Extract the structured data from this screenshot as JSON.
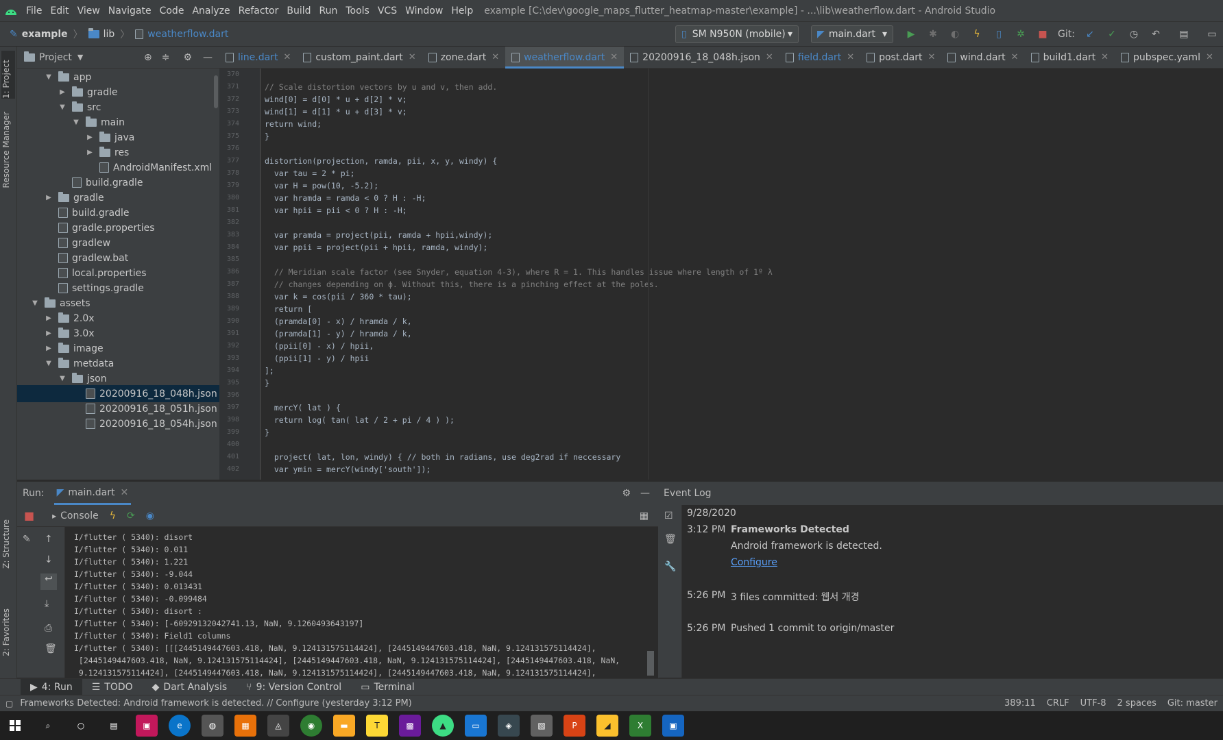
{
  "menu": {
    "items": [
      "File",
      "Edit",
      "View",
      "Navigate",
      "Code",
      "Analyze",
      "Refactor",
      "Build",
      "Run",
      "Tools",
      "VCS",
      "Window",
      "Help"
    ],
    "window_title": "example [C:\\dev\\google_maps_flutter_heatmap-master\\example] - ...\\lib\\weatherflow.dart - Android Studio"
  },
  "nav": {
    "breadcrumb": [
      "example",
      "lib",
      "weatherflow.dart"
    ],
    "device": "SM N950N (mobile)",
    "run_config": "main.dart",
    "git_label": "Git:"
  },
  "project_panel": {
    "title": "Project",
    "tree": [
      {
        "label": "app",
        "indent": 2,
        "arrow": "down",
        "kind": "folder"
      },
      {
        "label": "gradle",
        "indent": 3,
        "arrow": "right",
        "kind": "folder"
      },
      {
        "label": "src",
        "indent": 3,
        "arrow": "down",
        "kind": "folder"
      },
      {
        "label": "main",
        "indent": 4,
        "arrow": "down",
        "kind": "folder"
      },
      {
        "label": "java",
        "indent": 5,
        "arrow": "right",
        "kind": "folder"
      },
      {
        "label": "res",
        "indent": 5,
        "arrow": "right",
        "kind": "folder"
      },
      {
        "label": "AndroidManifest.xml",
        "indent": 5,
        "arrow": "",
        "kind": "file"
      },
      {
        "label": "build.gradle",
        "indent": 3,
        "arrow": "",
        "kind": "file"
      },
      {
        "label": "gradle",
        "indent": 2,
        "arrow": "right",
        "kind": "folder"
      },
      {
        "label": "build.gradle",
        "indent": 2,
        "arrow": "",
        "kind": "file"
      },
      {
        "label": "gradle.properties",
        "indent": 2,
        "arrow": "",
        "kind": "file"
      },
      {
        "label": "gradlew",
        "indent": 2,
        "arrow": "",
        "kind": "file"
      },
      {
        "label": "gradlew.bat",
        "indent": 2,
        "arrow": "",
        "kind": "file"
      },
      {
        "label": "local.properties",
        "indent": 2,
        "arrow": "",
        "kind": "file"
      },
      {
        "label": "settings.gradle",
        "indent": 2,
        "arrow": "",
        "kind": "file"
      },
      {
        "label": "assets",
        "indent": 1,
        "arrow": "down",
        "kind": "folder"
      },
      {
        "label": "2.0x",
        "indent": 2,
        "arrow": "right",
        "kind": "folder"
      },
      {
        "label": "3.0x",
        "indent": 2,
        "arrow": "right",
        "kind": "folder"
      },
      {
        "label": "image",
        "indent": 2,
        "arrow": "right",
        "kind": "folder"
      },
      {
        "label": "metdata",
        "indent": 2,
        "arrow": "down",
        "kind": "folder"
      },
      {
        "label": "json",
        "indent": 3,
        "arrow": "down",
        "kind": "folder"
      },
      {
        "label": "20200916_18_048h.json",
        "indent": 4,
        "arrow": "",
        "kind": "file",
        "selected": true
      },
      {
        "label": "20200916_18_051h.json",
        "indent": 4,
        "arrow": "",
        "kind": "file"
      },
      {
        "label": "20200916_18_054h.json",
        "indent": 4,
        "arrow": "",
        "kind": "file"
      }
    ]
  },
  "left_strip": {
    "project": "1: Project",
    "resource": "Resource Manager",
    "structure": "Z: Structure",
    "favorites": "2: Favorites"
  },
  "tabs": [
    {
      "label": "line.dart",
      "active": false,
      "color": "#4a88c7"
    },
    {
      "label": "custom_paint.dart",
      "active": false,
      "color": "#c8c8c8"
    },
    {
      "label": "zone.dart",
      "active": false,
      "color": "#c8c8c8"
    },
    {
      "label": "weatherflow.dart",
      "active": true,
      "color": "#4a88c7"
    },
    {
      "label": "20200916_18_048h.json",
      "active": false,
      "color": "#c8c8c8"
    },
    {
      "label": "field.dart",
      "active": false,
      "color": "#4a88c7"
    },
    {
      "label": "post.dart",
      "active": false,
      "color": "#c8c8c8"
    },
    {
      "label": "wind.dart",
      "active": false,
      "color": "#c8c8c8"
    },
    {
      "label": "build1.dart",
      "active": false,
      "color": "#c8c8c8"
    },
    {
      "label": "pubspec.yaml",
      "active": false,
      "color": "#c8c8c8"
    }
  ],
  "code": {
    "line_numbers": [
      "370",
      "371",
      "372",
      "373",
      "374",
      "375",
      "376",
      "377",
      "378",
      "379",
      "380",
      "381",
      "382",
      "383",
      "384",
      "385",
      "386",
      "387",
      "388",
      "389",
      "390",
      "391",
      "392",
      "393",
      "394",
      "395",
      "396",
      "397",
      "398",
      "399",
      "400",
      "401",
      "402"
    ],
    "lines": [
      "",
      "// Scale distortion vectors by u and v, then add.",
      "wind[0] = d[0] * u + d[2] * v;",
      "wind[1] = d[1] * u + d[3] * v;",
      "return wind;",
      "}",
      "",
      "distortion(projection, ramda, pii, x, y, windy) {",
      "  var tau = 2 * pi;",
      "  var H = pow(10, -5.2);",
      "  var hramda = ramda < 0 ? H : -H;",
      "  var hpii = pii < 0 ? H : -H;",
      "",
      "  var pramda = project(pii, ramda + hpii,windy);",
      "  var ppii = project(pii + hpii, ramda, windy);",
      "",
      "  // Meridian scale factor (see Snyder, equation 4-3), where R = 1. This handles issue where length of 1º λ",
      "  // changes depending on ϕ. Without this, there is a pinching effect at the poles.",
      "  var k = cos(pii / 360 * tau);",
      "  return [",
      "  (pramda[0] - x) / hramda / k,",
      "  (pramda[1] - y) / hramda / k,",
      "  (ppii[0] - x) / hpii,",
      "  (ppii[1] - y) / hpii",
      "];",
      "}",
      "",
      "  mercY( lat ) {",
      "  return log( tan( lat / 2 + pi / 4 ) );",
      "}",
      "",
      "  project( lat, lon, windy) { // both in radians, use deg2rad if neccessary",
      "  var ymin = mercY(windy['south']);"
    ]
  },
  "run_panel": {
    "label": "Run:",
    "tab": "main.dart",
    "console_tab": "Console",
    "output": [
      "I/flutter ( 5340): disort",
      "I/flutter ( 5340): 0.011",
      "I/flutter ( 5340): 1.221",
      "I/flutter ( 5340): -9.044",
      "I/flutter ( 5340): 0.013431",
      "I/flutter ( 5340): -0.099484",
      "I/flutter ( 5340): disort :",
      "I/flutter ( 5340): [-60929132042741.13, NaN, 9.1260493643197]",
      "I/flutter ( 5340): Field1 columns",
      "I/flutter ( 5340): [[[2445149447603.418, NaN, 9.124131575114424], [2445149447603.418, NaN, 9.124131575114424],",
      " [2445149447603.418, NaN, 9.124131575114424], [2445149447603.418, NaN, 9.124131575114424], [2445149447603.418, NaN,",
      " 9.124131575114424], [2445149447603.418, NaN, 9.124131575114424], [2445149447603.418, NaN, 9.124131575114424],"
    ]
  },
  "event_log": {
    "title": "Event Log",
    "date": "9/28/2020",
    "entries": [
      {
        "time": "3:12 PM",
        "title": "Frameworks Detected",
        "text": "Android framework is detected.",
        "link": "Configure"
      },
      {
        "time": "5:26 PM",
        "text": "3 files committed: 웹서 개경"
      },
      {
        "time": "5:26 PM",
        "text": "Pushed 1 commit to origin/master"
      }
    ]
  },
  "bottom_tabs": [
    "4: Run",
    "TODO",
    "Dart Analysis",
    "9: Version Control",
    "Terminal"
  ],
  "status": {
    "message": "Frameworks Detected: Android framework is detected. // Configure (yesterday 3:12 PM)",
    "position": "389:11",
    "line_sep": "CRLF",
    "encoding": "UTF-8",
    "indent": "2 spaces",
    "git": "Git: master"
  }
}
